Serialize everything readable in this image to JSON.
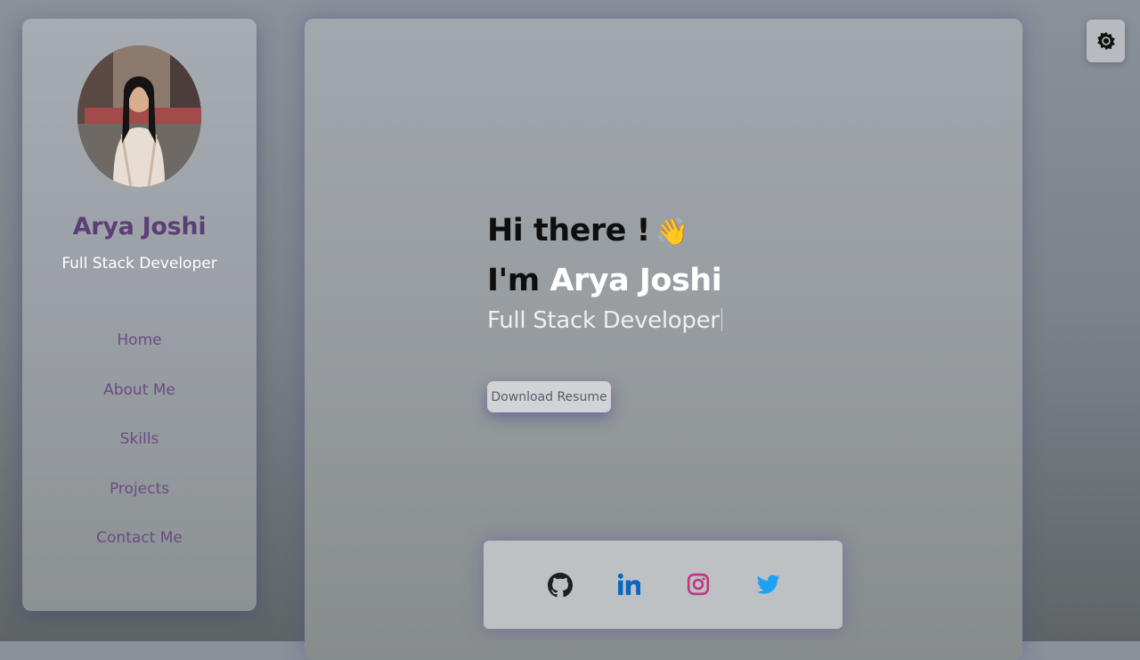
{
  "profile": {
    "name": "Arya Joshi",
    "role": "Full Stack Developer"
  },
  "nav": {
    "items": [
      {
        "label": "Home"
      },
      {
        "label": "About Me"
      },
      {
        "label": "Skills"
      },
      {
        "label": "Projects"
      },
      {
        "label": "Contact Me"
      }
    ]
  },
  "hero": {
    "greeting": "Hi there !",
    "wave_emoji": "👋",
    "intro_prefix": "I'm ",
    "intro_name": "Arya Joshi",
    "typed_text": "Full Stack Developer"
  },
  "actions": {
    "resume_label": "Download Resume"
  },
  "social": {
    "links": [
      {
        "icon": "github-icon",
        "color": "#1b1f23"
      },
      {
        "icon": "linkedin-icon",
        "color": "#0a66c2"
      },
      {
        "icon": "instagram-icon",
        "color": "#c13584"
      },
      {
        "icon": "twitter-icon",
        "color": "#1da1f2"
      }
    ]
  },
  "theme_toggle": {
    "icon": "sun-gear-icon"
  },
  "colors": {
    "accent_name": "#5d3f78",
    "nav_text": "#684d82"
  }
}
